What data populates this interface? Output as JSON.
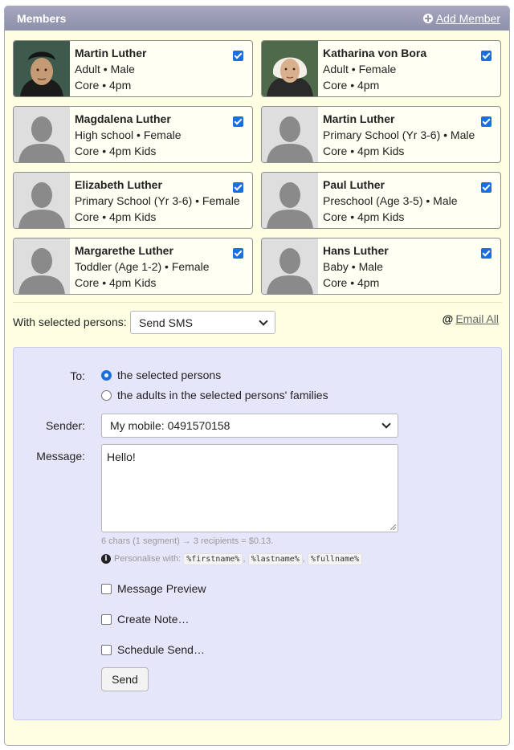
{
  "header": {
    "title": "Members",
    "add_member_label": "Add Member"
  },
  "members": [
    {
      "name": "Martin Luther",
      "line1": "Adult • Male",
      "line2": "Core • 4pm",
      "checked": true,
      "avatar": "portrait-man"
    },
    {
      "name": "Katharina von Bora",
      "line1": "Adult • Female",
      "line2": "Core • 4pm",
      "checked": true,
      "avatar": "portrait-woman"
    },
    {
      "name": "Magdalena Luther",
      "line1": "High school • Female",
      "line2": "Core • 4pm Kids",
      "checked": true,
      "avatar": "silhouette"
    },
    {
      "name": "Martin Luther",
      "line1": "Primary School (Yr 3-6) • Male",
      "line2": "Core • 4pm Kids",
      "checked": true,
      "avatar": "silhouette"
    },
    {
      "name": "Elizabeth Luther",
      "line1": "Primary School (Yr 3-6) • Female",
      "line2": "Core • 4pm Kids",
      "checked": true,
      "avatar": "silhouette"
    },
    {
      "name": "Paul Luther",
      "line1": "Preschool (Age 3-5) • Male",
      "line2": "Core • 4pm Kids",
      "checked": true,
      "avatar": "silhouette"
    },
    {
      "name": "Margarethe Luther",
      "line1": "Toddler (Age 1-2) • Female",
      "line2": "Core • 4pm Kids",
      "checked": true,
      "avatar": "silhouette"
    },
    {
      "name": "Hans Luther",
      "line1": "Baby • Male",
      "line2": "Core • 4pm",
      "checked": true,
      "avatar": "silhouette"
    }
  ],
  "actions": {
    "label": "With selected persons:",
    "selected": "Send SMS",
    "email_all": "Email All"
  },
  "sms": {
    "to_label": "To:",
    "to_options": [
      "the selected persons",
      "the adults in the selected persons' families"
    ],
    "to_selected": 0,
    "sender_label": "Sender:",
    "sender_value": "My mobile: 0491570158",
    "message_label": "Message:",
    "message_value": "Hello!",
    "count_hint": "6 chars (1 segment) → 3 recipients = $0.13.",
    "personalise_label": "Personalise with:",
    "tokens": [
      "%firstname%",
      "%lastname%",
      "%fullname%"
    ],
    "options": [
      "Message Preview",
      "Create Note…",
      "Schedule Send…"
    ],
    "send_label": "Send"
  },
  "colors": {
    "accent": "#1a6fe0",
    "header": "#9a9cb5",
    "panel_bg": "#fefee3",
    "sms_bg": "#e6e6fb"
  }
}
